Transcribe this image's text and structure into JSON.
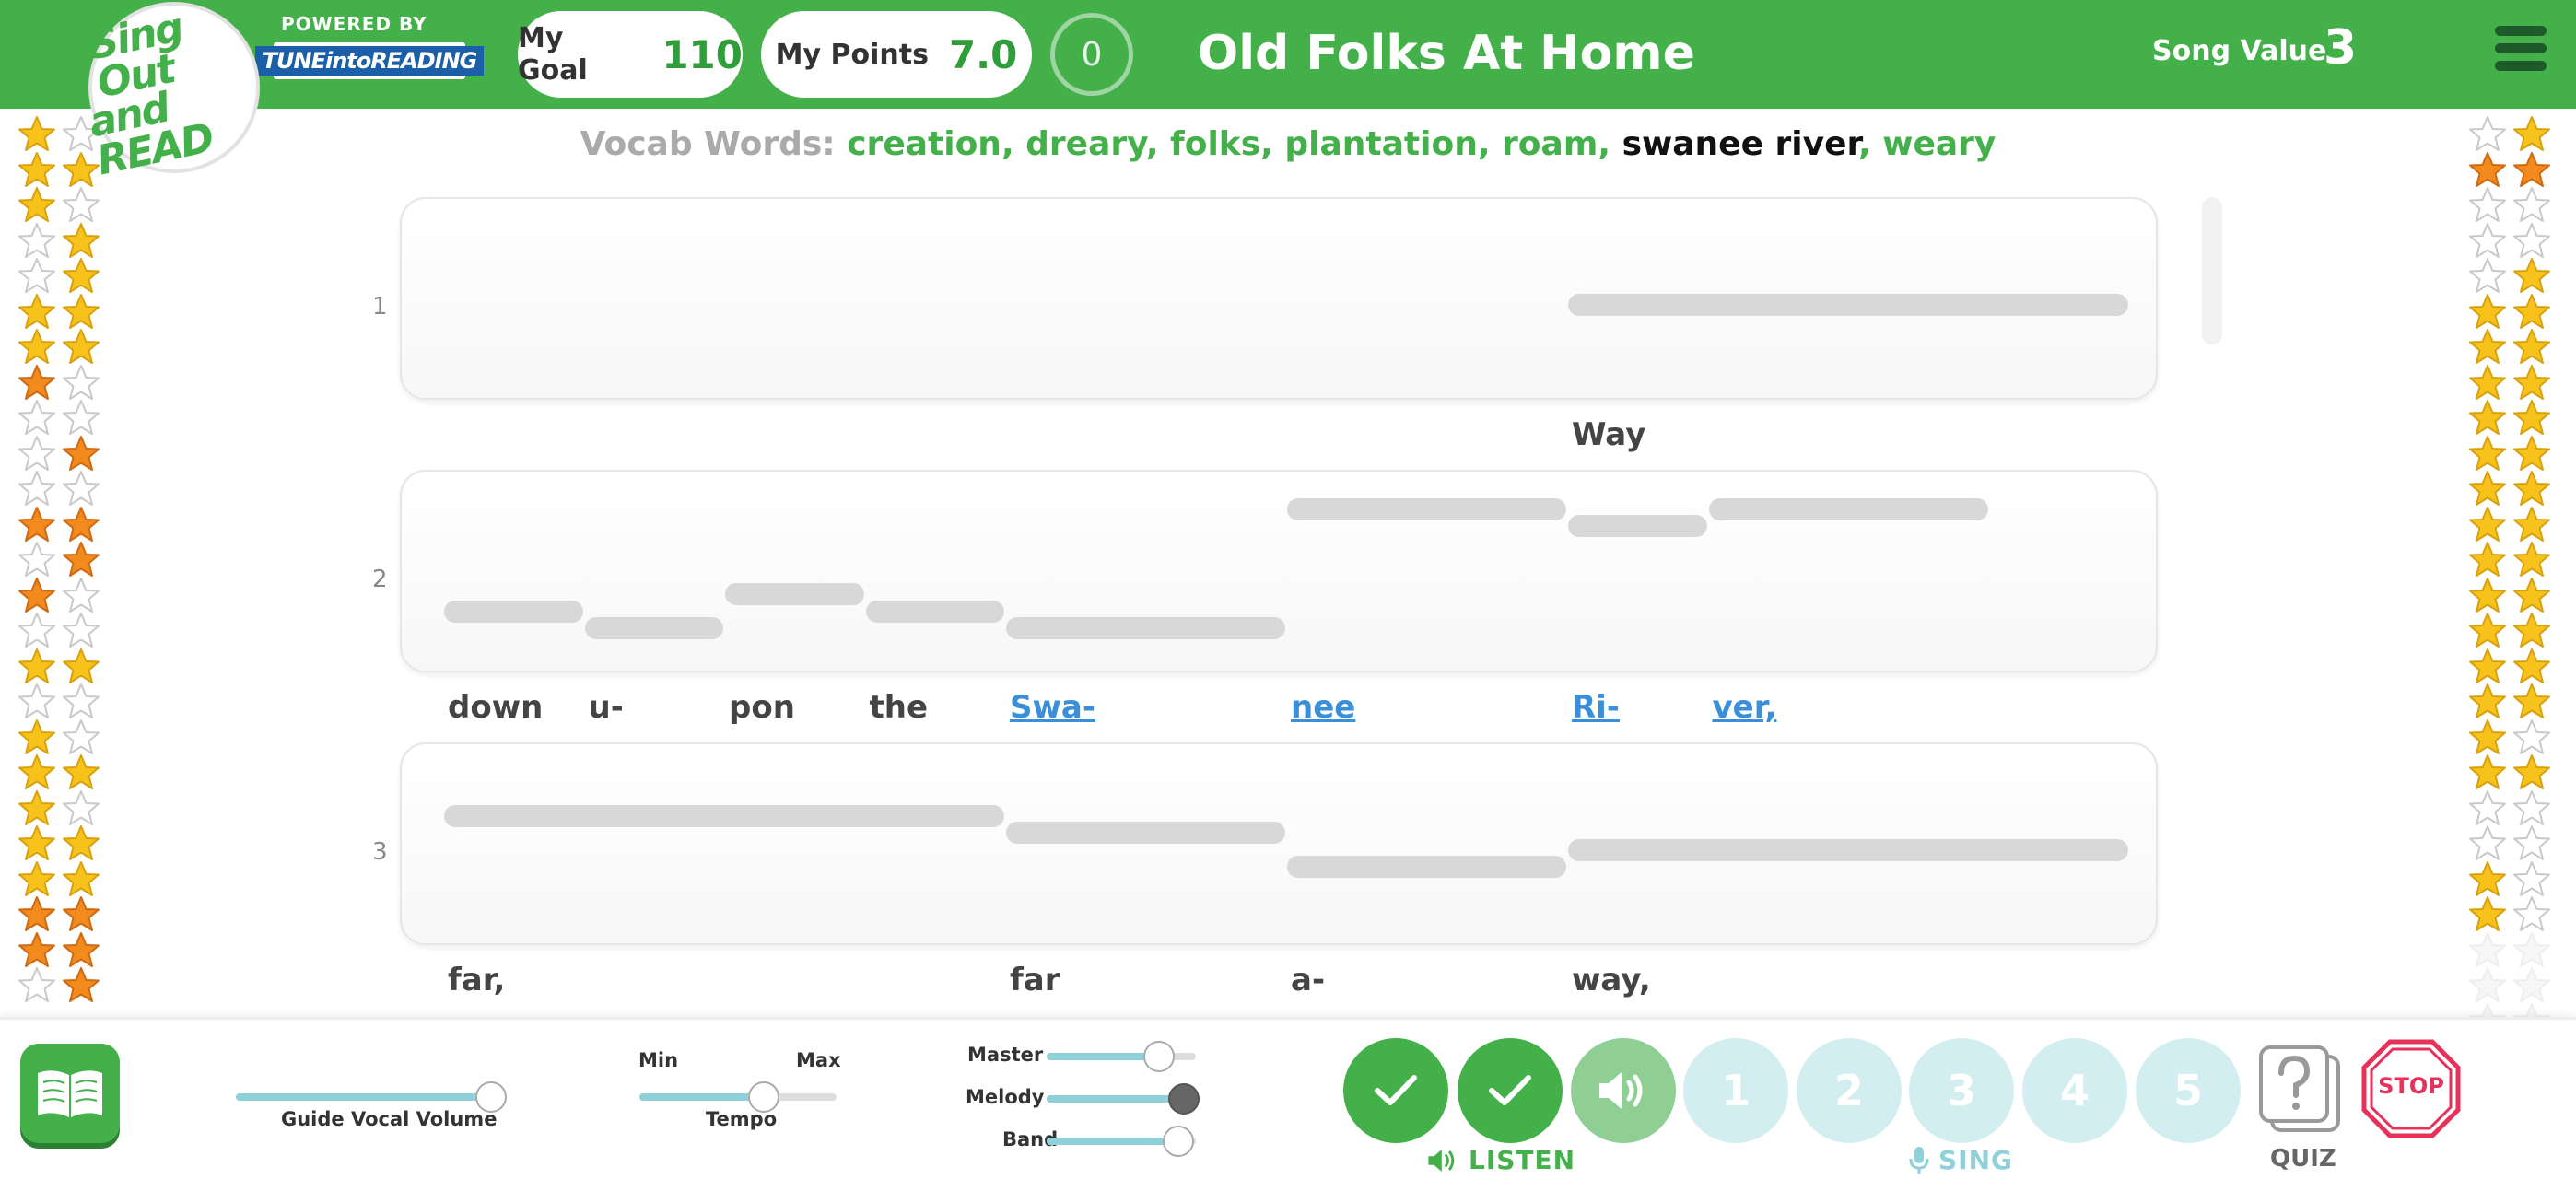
{
  "header": {
    "logo": {
      "line1": "Sing Out",
      "line2": "and READ"
    },
    "powered_by": "POWERED BY",
    "tune_logo": "TUNEintoREADING",
    "goal": {
      "label": "My Goal",
      "value": "110"
    },
    "points": {
      "label": "My Points",
      "value": "7.0"
    },
    "counter": "0",
    "song_title": "Old Folks At Home",
    "song_value_label": "Song Value",
    "song_value": "3"
  },
  "vocab": {
    "label": "Vocab Words:",
    "words": [
      {
        "text": "creation",
        "highlight": false
      },
      {
        "text": "dreary",
        "highlight": false
      },
      {
        "text": "folks",
        "highlight": false
      },
      {
        "text": "plantation",
        "highlight": false
      },
      {
        "text": "roam",
        "highlight": false
      },
      {
        "text": "swanee river",
        "highlight": true
      },
      {
        "text": "weary",
        "highlight": false
      }
    ]
  },
  "lines": [
    {
      "number": "1",
      "notes": [
        {
          "col": 8,
          "len": 4,
          "pitch": 5
        }
      ],
      "lyrics": [
        {
          "text": "Way",
          "col": 8,
          "link": false
        }
      ]
    },
    {
      "number": "2",
      "notes": [
        {
          "col": 0,
          "len": 1,
          "pitch": 7
        },
        {
          "col": 1,
          "len": 1,
          "pitch": 8
        },
        {
          "col": 2,
          "len": 1,
          "pitch": 6
        },
        {
          "col": 3,
          "len": 1,
          "pitch": 7
        },
        {
          "col": 4,
          "len": 2,
          "pitch": 8
        },
        {
          "col": 6,
          "len": 2,
          "pitch": 1
        },
        {
          "col": 8,
          "len": 1,
          "pitch": 2
        },
        {
          "col": 9,
          "len": 2,
          "pitch": 1
        }
      ],
      "lyrics": [
        {
          "text": "down",
          "col": 0,
          "link": false
        },
        {
          "text": "u-",
          "col": 1,
          "link": false
        },
        {
          "text": "pon",
          "col": 2,
          "link": false
        },
        {
          "text": "the",
          "col": 3,
          "link": false
        },
        {
          "text": "Swa-",
          "col": 4,
          "link": true
        },
        {
          "text": "nee",
          "col": 6,
          "link": true
        },
        {
          "text": "Ri-",
          "col": 8,
          "link": true
        },
        {
          "text": "ver,",
          "col": 9,
          "link": true
        }
      ]
    },
    {
      "number": "3",
      "notes": [
        {
          "col": 0,
          "len": 4,
          "pitch": 3
        },
        {
          "col": 4,
          "len": 2,
          "pitch": 4
        },
        {
          "col": 6,
          "len": 2,
          "pitch": 6
        },
        {
          "col": 8,
          "len": 4,
          "pitch": 5
        }
      ],
      "lyrics": [
        {
          "text": "far,",
          "col": 0,
          "link": false
        },
        {
          "text": "far",
          "col": 4,
          "link": false
        },
        {
          "text": "a-",
          "col": 6,
          "link": false
        },
        {
          "text": "way,",
          "col": 8,
          "link": false
        }
      ]
    }
  ],
  "stars": {
    "left": [
      [
        "gold",
        "white"
      ],
      [
        "gold",
        "gold"
      ],
      [
        "gold",
        "white"
      ],
      [
        "white",
        "gold"
      ],
      [
        "white",
        "gold"
      ],
      [
        "gold",
        "gold"
      ],
      [
        "gold",
        "gold"
      ],
      [
        "orange",
        "white"
      ],
      [
        "white",
        "white"
      ],
      [
        "white",
        "orange"
      ],
      [
        "white",
        "white"
      ],
      [
        "orange",
        "orange"
      ],
      [
        "white",
        "orange"
      ],
      [
        "orange",
        "white"
      ],
      [
        "white",
        "white"
      ],
      [
        "gold",
        "gold"
      ],
      [
        "white",
        "white"
      ],
      [
        "gold",
        "white"
      ],
      [
        "gold",
        "gold"
      ],
      [
        "gold",
        "white"
      ],
      [
        "gold",
        "gold"
      ],
      [
        "gold",
        "gold"
      ],
      [
        "orange",
        "orange"
      ],
      [
        "orange",
        "orange"
      ],
      [
        "white",
        "orange"
      ]
    ],
    "right": [
      [
        "white",
        "gold"
      ],
      [
        "orange",
        "orange"
      ],
      [
        "white",
        "white"
      ],
      [
        "white",
        "white"
      ],
      [
        "white",
        "gold"
      ],
      [
        "gold",
        "gold"
      ],
      [
        "gold",
        "gold"
      ],
      [
        "gold",
        "gold"
      ],
      [
        "gold",
        "gold"
      ],
      [
        "gold",
        "gold"
      ],
      [
        "gold",
        "gold"
      ],
      [
        "gold",
        "gold"
      ],
      [
        "gold",
        "gold"
      ],
      [
        "gold",
        "gold"
      ],
      [
        "gold",
        "gold"
      ],
      [
        "gold",
        "gold"
      ],
      [
        "gold",
        "gold"
      ],
      [
        "gold",
        "white"
      ],
      [
        "gold",
        "gold"
      ],
      [
        "white",
        "white"
      ],
      [
        "white",
        "white"
      ],
      [
        "gold",
        "white"
      ],
      [
        "gold",
        "white"
      ],
      [
        "faint",
        "faint"
      ],
      [
        "faint",
        "faint"
      ],
      [
        "faint",
        "faint"
      ]
    ]
  },
  "controls": {
    "guide_vocal": {
      "label": "Guide Vocal Volume",
      "level": 0.95
    },
    "tempo": {
      "label": "Tempo",
      "min_label": "Min",
      "max_label": "Max",
      "level": 0.63
    },
    "mix": [
      {
        "label": "Master",
        "level": 0.75
      },
      {
        "label": "Melody",
        "level": 1.0
      },
      {
        "label": "Band",
        "level": 0.88
      }
    ],
    "listen_label": "LISTEN",
    "sing_label": "SING",
    "sing_buttons": [
      "1",
      "2",
      "3",
      "4",
      "5"
    ],
    "quiz_label": "QUIZ",
    "stop_label": "STOP"
  },
  "colors": {
    "brand_green": "#43b04a",
    "accent_blue": "#3a8fd8",
    "star_gold": "#f7c21b",
    "star_orange": "#f28a1e"
  }
}
